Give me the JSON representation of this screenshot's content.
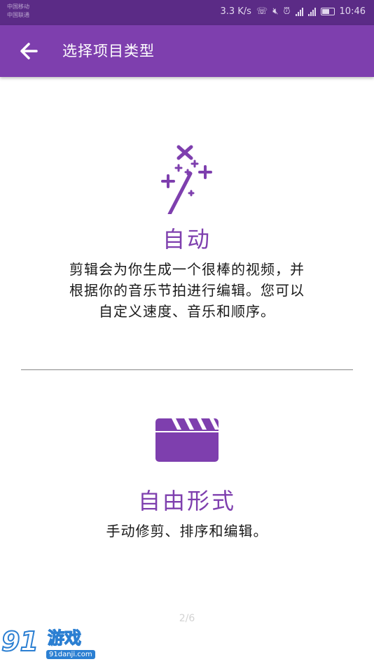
{
  "status_bar": {
    "carrier_1": "中国移动",
    "carrier_2": "中国联通",
    "network_speed": "3.3 K/s",
    "time": "10:46"
  },
  "app_bar": {
    "title": "选择项目类型",
    "back_icon": "arrow-left-icon"
  },
  "options": {
    "auto": {
      "icon": "magic-wand-icon",
      "title": "自动",
      "description": "剪辑会为你生成一个很棒的视频，并根据你的音乐节拍进行编辑。您可以自定义速度、音乐和顺序。"
    },
    "freeform": {
      "icon": "clapperboard-icon",
      "title": "自由形式",
      "description": "手动修剪、排序和编辑。"
    }
  },
  "pager": {
    "indicator": "2/6"
  },
  "watermark": {
    "logo": "91",
    "name": "游戏",
    "domain": "91danji.com"
  },
  "colors": {
    "status_bar": "#5b2b86",
    "app_bar": "#7e3fae",
    "accent": "#7e3fae",
    "background": "#ffffff"
  }
}
